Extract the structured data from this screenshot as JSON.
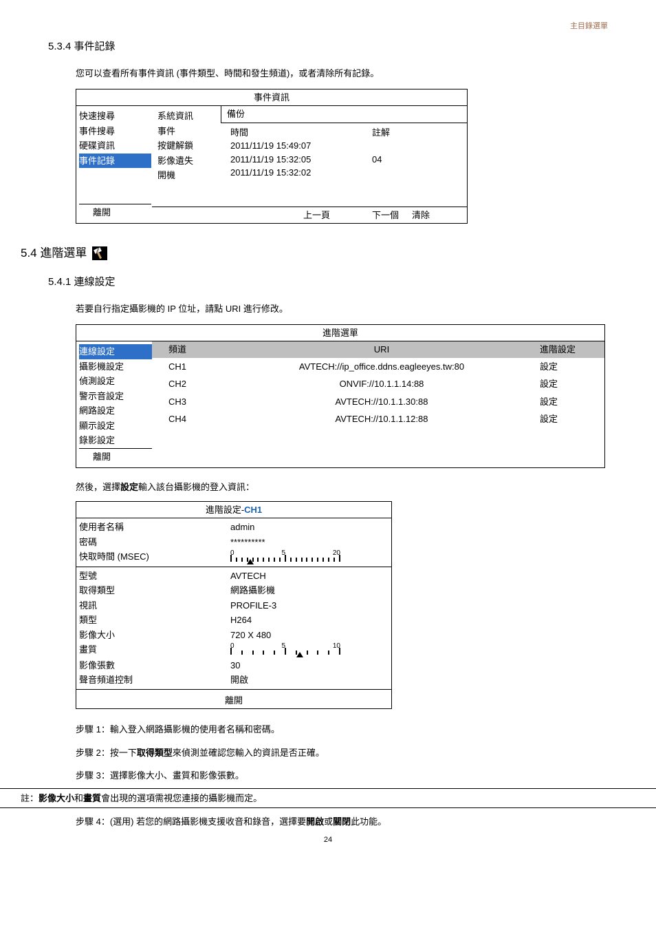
{
  "header_right": "主目錄選單",
  "sec_534_title": "5.3.4  事件記錄",
  "sec_534_desc": "您可以查看所有事件資訊 (事件類型、時間和發生頻道)，或者清除所有記錄。",
  "event_table": {
    "title": "事件資訊",
    "left_items": [
      "快速搜尋",
      "事件搜尋",
      "硬碟資訊",
      "事件記錄"
    ],
    "highlight_index": 3,
    "leave": "離開",
    "mid_items": [
      "系統資訊",
      "事件",
      "按鍵解鎖",
      "影像遺失",
      "開機"
    ],
    "right_top": "備份",
    "col_time_hdr": "時間",
    "col_note_hdr": "註解",
    "rows": [
      {
        "time": "2011/11/19 15:49:07",
        "note": ""
      },
      {
        "time": "2011/11/19 15:32:05",
        "note": "04"
      },
      {
        "time": "2011/11/19 15:32:02",
        "note": ""
      }
    ],
    "footer_prev": "上一頁",
    "footer_next": "下一個",
    "footer_clear": "清除"
  },
  "sec_54_title": "5.4  進階選單",
  "sec_541_title": "5.4.1  連線設定",
  "sec_541_desc": "若要自行指定攝影機的 IP 位址，請點 URI 進行修改。",
  "adv_table": {
    "title": "進階選單",
    "left_items": [
      "連線設定",
      "攝影機設定",
      "偵測設定",
      "警示音設定",
      "網路設定",
      "顯示設定",
      "錄影設定"
    ],
    "highlight_index": 0,
    "leave": "離開",
    "hdr_ch": "頻道",
    "hdr_uri": "URI",
    "hdr_set": "進階設定",
    "rows": [
      {
        "ch": "CH1",
        "uri": "AVTECH://ip_office.ddns.eagleeyes.tw:80",
        "set": "設定"
      },
      {
        "ch": "CH2",
        "uri": "ONVIF://10.1.1.14:88",
        "set": "設定"
      },
      {
        "ch": "CH3",
        "uri": "AVTECH://10.1.1.30:88",
        "set": "設定"
      },
      {
        "ch": "CH4",
        "uri": "AVTECH://10.1.1.12:88",
        "set": "設定"
      }
    ]
  },
  "then_text_1": "然後，選擇",
  "then_text_bold": "設定",
  "then_text_2": "輸入該台攝影機的登入資訊：",
  "ch1_table": {
    "title_prefix": "進階設定-",
    "title_ch": "CH1",
    "rows1": [
      {
        "label": "使用者名稱",
        "val": "admin"
      },
      {
        "label": "密碼",
        "val": "**********"
      }
    ],
    "cache_label": "快取時間 (MSEC)",
    "cache_slider": {
      "min": "0",
      "mid": "5",
      "max": "20",
      "pos": 15
    },
    "rows2": [
      {
        "label": "型號",
        "val": "AVTECH"
      },
      {
        "label": "取得類型",
        "val": "網路攝影機"
      },
      {
        "label": "視訊",
        "val": "PROFILE-3"
      },
      {
        "label": "類型",
        "val": "H264"
      },
      {
        "label": "影像大小",
        "val": "720 X 480"
      }
    ],
    "quality_label": "畫質",
    "quality_slider": {
      "min": "0",
      "mid": "5",
      "max": "10",
      "pos": 60
    },
    "rows3": [
      {
        "label": "影像張數",
        "val": "30"
      },
      {
        "label": "聲音頻道控制",
        "val": "開啟"
      }
    ],
    "leave": "離開"
  },
  "step1": "步驟 1：輸入登入網路攝影機的使用者名稱和密碼。",
  "step2_a": "步驟 2：按一下",
  "step2_b": "取得類型",
  "step2_c": "來偵測並確認您輸入的資訊是否正確。",
  "step3": "步驟 3：選擇影像大小、畫質和影像張數。",
  "note_a": "註：",
  "note_b": "影像大小",
  "note_c": "和",
  "note_d": "畫質",
  "note_e": "會出現的選項需視您連接的攝影機而定。",
  "step4_a": "步驟 4：(選用) 若您的網路攝影機支援收音和錄音，選擇要",
  "step4_b": "開啟",
  "step4_c": "或",
  "step4_d": "關閉",
  "step4_e": "此功能。",
  "page_num": "24"
}
